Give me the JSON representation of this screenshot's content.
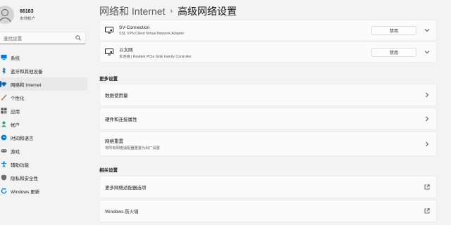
{
  "window": {
    "breadcrumb_parent": "网络和 Internet",
    "breadcrumb_current": "高级网络设置"
  },
  "user": {
    "name": "86183",
    "account": "本地帐户"
  },
  "search": {
    "placeholder": "查找设置"
  },
  "sidebar": {
    "items": [
      {
        "label": "系统",
        "icon": "monitor-icon",
        "color": "#0078d4"
      },
      {
        "label": "蓝牙和其他设备",
        "icon": "bluetooth-icon",
        "color": "#0078d4"
      },
      {
        "label": "网络和 Internet",
        "icon": "wifi-icon",
        "color": "#0067c0",
        "active": true
      },
      {
        "label": "个性化",
        "icon": "brush-icon",
        "color": "#d87a1e"
      },
      {
        "label": "应用",
        "icon": "apps-icon",
        "color": "#5a5a5a"
      },
      {
        "label": "帐户",
        "icon": "person-icon",
        "color": "#2aa26a"
      },
      {
        "label": "时间和语言",
        "icon": "globe-clock-icon",
        "color": "#0078d4"
      },
      {
        "label": "游戏",
        "icon": "gamepad-icon",
        "color": "#6b6b6b"
      },
      {
        "label": "辅助功能",
        "icon": "accessibility-icon",
        "color": "#0078d4"
      },
      {
        "label": "隐私和安全性",
        "icon": "shield-icon",
        "color": "#6b6b6b"
      },
      {
        "label": "Windows 更新",
        "icon": "update-icon",
        "color": "#0078d4"
      }
    ]
  },
  "adapters": [
    {
      "name": "SV-Connection",
      "desc": "SSL VPN Client Virtual Network Adapter",
      "button": "禁用"
    },
    {
      "name": "以太网",
      "desc": "未连接 | Realtek PCIe GbE Family Controller",
      "button": "禁用"
    }
  ],
  "more_settings": {
    "title": "更多设置",
    "rows": [
      {
        "label": "数据使用量"
      },
      {
        "label": "硬件和连接属性"
      },
      {
        "label": "网络重置",
        "sub": "将所有网络适配器重置为出厂设置"
      }
    ]
  },
  "related_settings": {
    "title": "相关设置",
    "rows": [
      {
        "label": "更多网络适配器选项"
      },
      {
        "label": "Windows 防火墙"
      }
    ]
  },
  "colors": {
    "accent": "#005fb8",
    "background": "#f3f3f3",
    "card": "#fbfbfb"
  }
}
